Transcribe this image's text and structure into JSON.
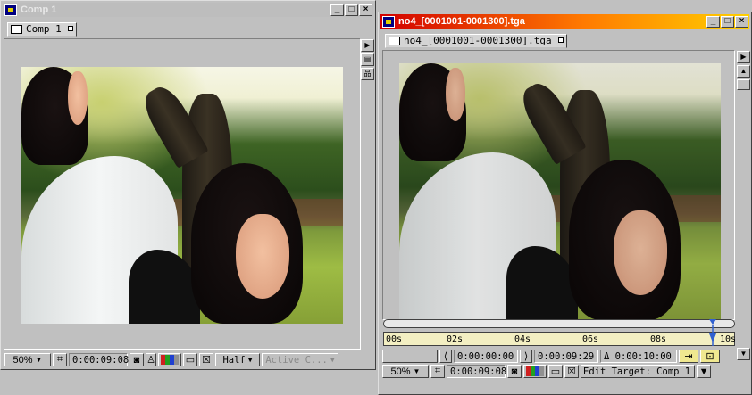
{
  "comp_window": {
    "title": "Comp 1",
    "tab_label": "Comp 1",
    "zoom": "50%",
    "timecode": "0:00:09:08",
    "resolution": "Half",
    "camera": "Active C..."
  },
  "footage_window": {
    "title": "no4_[0001001-0001300].tga",
    "tab_label": "no4_[0001001-0001300].tga",
    "ruler_ticks": [
      "00s",
      "02s",
      "04s",
      "06s",
      "08s",
      "10s"
    ],
    "current_time_fraction": 0.95,
    "in_point": "0:00:00:00",
    "out_point": "0:00:09:29",
    "duration": "Δ 0:00:10:00",
    "zoom": "50%",
    "timecode": "0:00:09:08",
    "edit_target": "Edit Target: Comp 1"
  },
  "colors": {
    "active_title_start": "#d20000",
    "active_title_end": "#ffd000",
    "ruler_bg": "#f3efc2"
  },
  "icons": {
    "window_min": "_",
    "window_max": "□",
    "window_close": "×",
    "menu_arrow": "▶",
    "scroll_up": "▲",
    "scroll_down": "▼",
    "dropdown": "▼"
  }
}
